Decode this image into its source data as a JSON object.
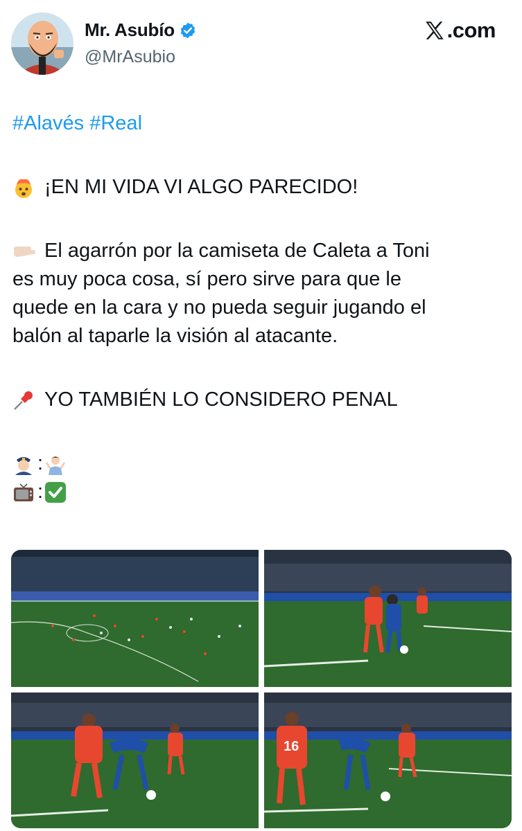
{
  "author": {
    "display_name": "Mr. Asubío",
    "handle": "@MrAsubio",
    "verified": true,
    "avatar": "cartoon-bald-bearded-man-avatar"
  },
  "brand": {
    "text": ".com",
    "logo": "x-logo-icon"
  },
  "tweet": {
    "hashtags": [
      "#Alavés",
      "#Real"
    ],
    "line1": "¡EN MI VIDA VI ALGO PARECIDO!",
    "line1_icon": "exploding-head-emoji",
    "para_icon": "pointing-hand-emoji",
    "para_lines": [
      "El agarrón por la camiseta de Caleta a Toni",
      "es muy poca cosa, sí pero sirve para que le",
      "quede en la cara y no pueda seguir jugando el",
      "balón al taparle la visión al atacante."
    ],
    "line3": "YO TAMBIÉN LO CONSIDERO PENAL",
    "line3_icon": "pushpin-emoji",
    "verdicts": [
      {
        "left": "police-officer-emoji",
        "sep": ":",
        "right": "shrugging-person-emoji"
      },
      {
        "left": "television-emoji",
        "sep": ":",
        "right": "check-mark-emoji"
      }
    ]
  },
  "media": [
    {
      "alt": "wide-shot-of-pitch"
    },
    {
      "alt": "closeup-tackle-1"
    },
    {
      "alt": "closeup-tackle-2"
    },
    {
      "alt": "closeup-tackle-3",
      "shirt_number": "16"
    }
  ],
  "colors": {
    "hashtag": "#1d9bf0",
    "verified": "#1d9bf0",
    "handle": "#536471",
    "pitch": "#2e6b2a",
    "kit_red": "#e8472f",
    "kit_blue": "#1f4fa8"
  }
}
